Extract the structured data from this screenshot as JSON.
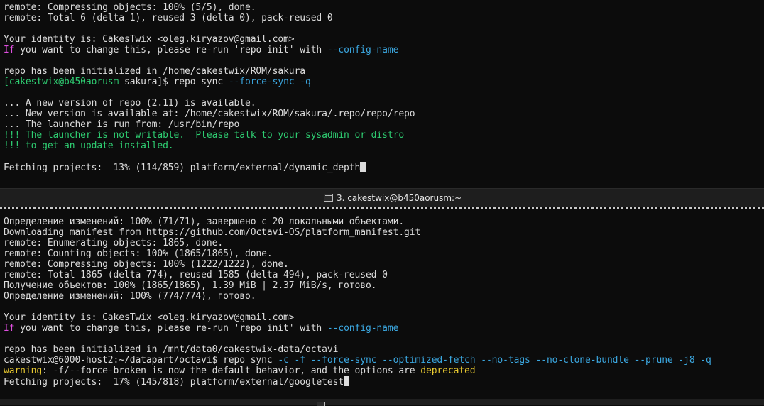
{
  "top_pane": {
    "lines": [
      [
        {
          "t": "remote: Compressing objects: 100% (5/5), done.",
          "c": "white"
        }
      ],
      [
        {
          "t": "remote: Total 6 (delta 1), reused 3 (delta 0), pack-reused 0",
          "c": "white"
        }
      ],
      [
        {
          "t": "",
          "c": "white"
        }
      ],
      [
        {
          "t": "Your identity is: CakesTwix <oleg.kiryazov@gmail.com>",
          "c": "white"
        }
      ],
      [
        {
          "t": "If",
          "c": "magenta"
        },
        {
          "t": " you want to change this, please re-run 'repo init' with ",
          "c": "white"
        },
        {
          "t": "--config-name",
          "c": "cyan"
        }
      ],
      [
        {
          "t": "",
          "c": "white"
        }
      ],
      [
        {
          "t": "repo has been initialized in /home/cakestwix/ROM/sakura",
          "c": "white"
        }
      ],
      [
        {
          "t": "[cakestwix@b450aorusm",
          "c": "green"
        },
        {
          "t": " sakura]$ repo sync ",
          "c": "white"
        },
        {
          "t": "--force-sync -q",
          "c": "cyan"
        }
      ],
      [
        {
          "t": "",
          "c": "white"
        }
      ],
      [
        {
          "t": "... A new version of repo (2.11) is available.",
          "c": "white"
        }
      ],
      [
        {
          "t": "... New version is available at: /home/cakestwix/ROM/sakura/.repo/repo/repo",
          "c": "white"
        }
      ],
      [
        {
          "t": "... The launcher is run from: /usr/bin/repo",
          "c": "white"
        }
      ],
      [
        {
          "t": "!!! The launcher is not writable.  Please talk to your sysadmin or distro",
          "c": "green"
        }
      ],
      [
        {
          "t": "!!! to get an update installed.",
          "c": "green"
        }
      ],
      [
        {
          "t": "",
          "c": "white"
        }
      ],
      [
        {
          "t": "Fetching projects:  13% (114/859) platform/external/dynamic_depth",
          "c": "white"
        },
        {
          "cursor": true
        }
      ]
    ]
  },
  "tab_bar": {
    "title": "3. cakestwix@b450aorusm:~",
    "icon": "terminal-icon"
  },
  "bottom_pane": {
    "lines": [
      [
        {
          "t": "Определение изменений: 100% (71/71), завершено с 20 локальными объектами.",
          "c": "white"
        }
      ],
      [
        {
          "t": "Downloading manifest from ",
          "c": "white"
        },
        {
          "t": "https://github.com/Octavi-OS/platform_manifest.git",
          "c": "link"
        }
      ],
      [
        {
          "t": "remote: Enumerating objects: 1865, done.",
          "c": "white"
        }
      ],
      [
        {
          "t": "remote: Counting objects: 100% (1865/1865), done.",
          "c": "white"
        }
      ],
      [
        {
          "t": "remote: Compressing objects: 100% (1222/1222), done.",
          "c": "white"
        }
      ],
      [
        {
          "t": "remote: Total 1865 (delta 774), reused 1585 (delta 494), pack-reused 0",
          "c": "white"
        }
      ],
      [
        {
          "t": "Получение объектов: 100% (1865/1865), 1.39 MiB | 2.37 MiB/s, готово.",
          "c": "white"
        }
      ],
      [
        {
          "t": "Определение изменений: 100% (774/774), готово.",
          "c": "white"
        }
      ],
      [
        {
          "t": "",
          "c": "white"
        }
      ],
      [
        {
          "t": "Your identity is: CakesTwix <oleg.kiryazov@gmail.com>",
          "c": "white"
        }
      ],
      [
        {
          "t": "If",
          "c": "magenta"
        },
        {
          "t": " you want to change this, please re-run 'repo init' with ",
          "c": "white"
        },
        {
          "t": "--config-name",
          "c": "cyan"
        }
      ],
      [
        {
          "t": "",
          "c": "white"
        }
      ],
      [
        {
          "t": "repo has been initialized in /mnt/data0/cakestwix-data/octavi",
          "c": "white"
        }
      ],
      [
        {
          "t": "cakestwix@6000-host2:~/datapart/octavi$ repo sync ",
          "c": "white"
        },
        {
          "t": "-c -f --force-sync --optimized-fetch --no-tags --no-clone-bundle --prune -j8 -q",
          "c": "cyan"
        }
      ],
      [
        {
          "t": "warning",
          "c": "yellow"
        },
        {
          "t": ": -f/--force-broken is now the default behavior, and the options are ",
          "c": "white"
        },
        {
          "t": "deprecated",
          "c": "yellow"
        }
      ],
      [
        {
          "t": "Fetching projects:  17% (145/818) platform/external/googletest",
          "c": "white"
        },
        {
          "cursor": true
        }
      ]
    ]
  },
  "colors": {
    "background": "#0c0c0c",
    "text": "#dcdcdc",
    "magenta": "#e04fe0",
    "cyan": "#3ba7e0",
    "green": "#2ecc71",
    "yellow": "#e8c930"
  }
}
